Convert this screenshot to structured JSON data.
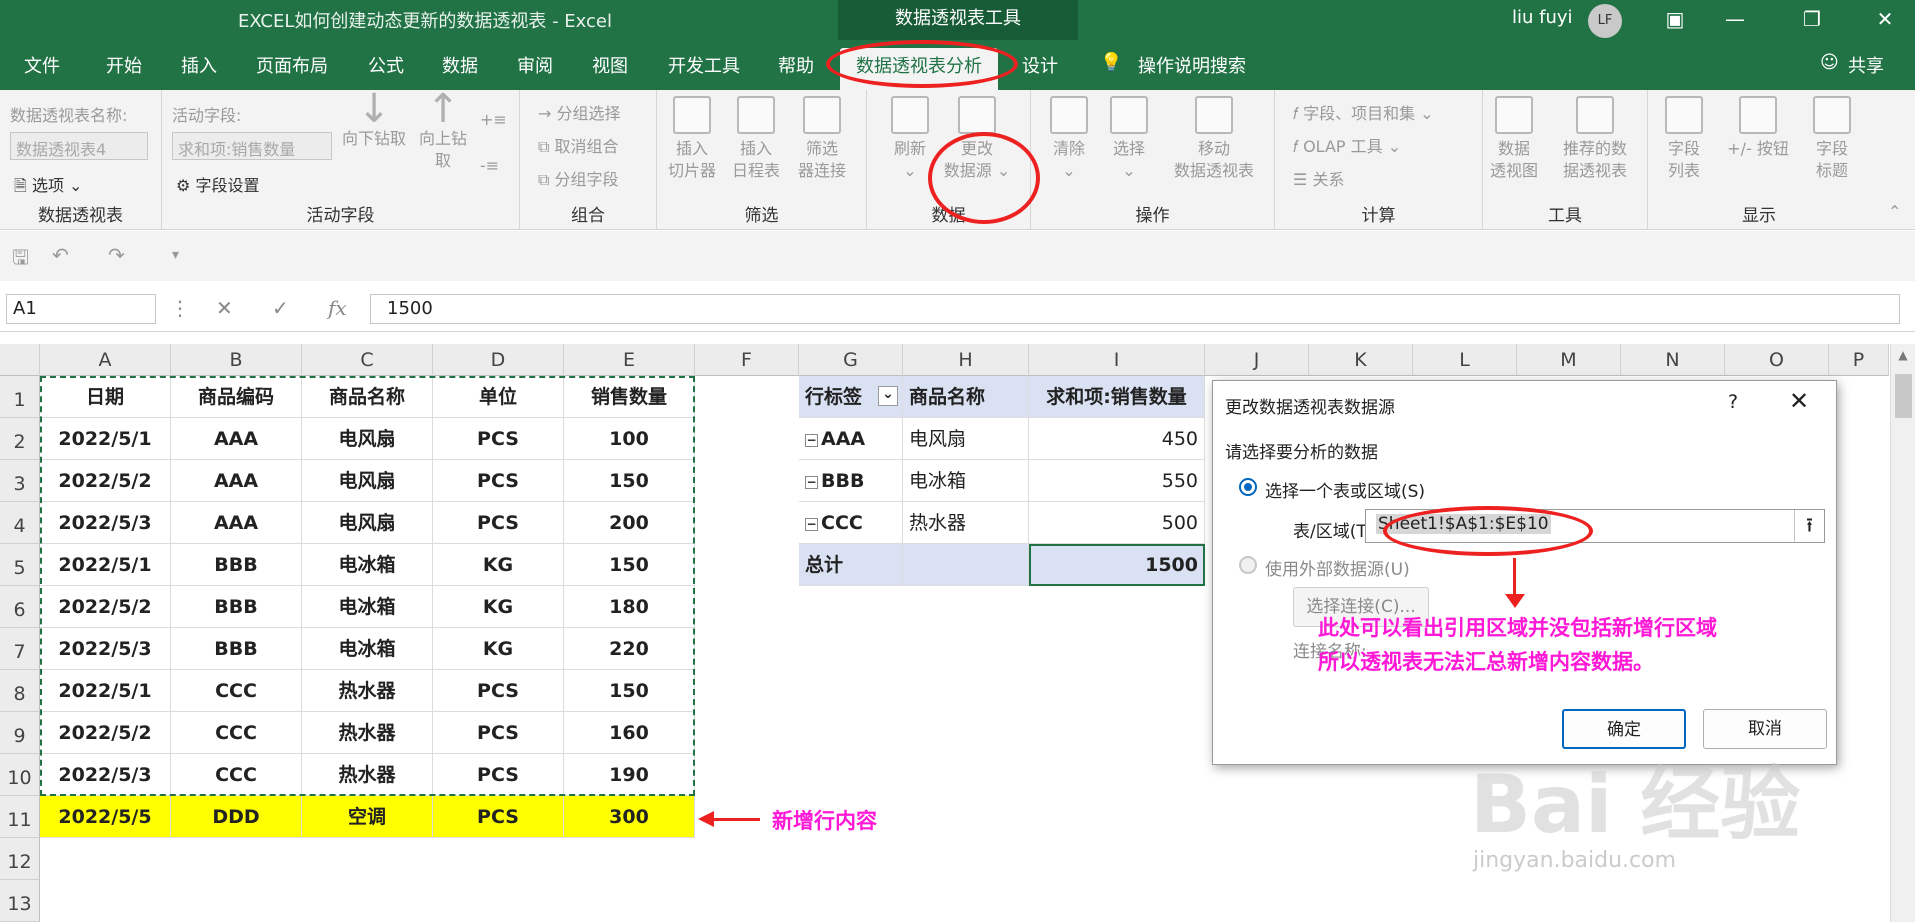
{
  "window": {
    "title": "EXCEL如何创建动态更新的数据透视表  -  Excel",
    "contextual_tools": "数据透视表工具",
    "user": "liu fuyi",
    "avatar": "LF"
  },
  "tabs": [
    "文件",
    "开始",
    "插入",
    "页面布局",
    "公式",
    "数据",
    "审阅",
    "视图",
    "开发工具",
    "帮助",
    "数据透视表分析",
    "设计"
  ],
  "tell_me": "操作说明搜索",
  "share": "共享",
  "ribbon": {
    "pivot_name_label": "数据透视表名称:",
    "pivot_name_value": "数据透视表4",
    "options": "选项",
    "group_pivot": "数据透视表",
    "active_field_label": "活动字段:",
    "active_field_value": "求和项:销售数量",
    "field_settings": "字段设置",
    "drill_down": "向下钻取",
    "drill_up": "向上钻",
    "drill_up2": "取",
    "group_active": "活动字段",
    "group_selection": "分组选择",
    "ungroup": "取消组合",
    "group_field": "分组字段",
    "group_group": "组合",
    "insert_slicer_1": "插入",
    "insert_slicer_2": "切片器",
    "insert_timeline_1": "插入",
    "insert_timeline_2": "日程表",
    "filter_conn_1": "筛选",
    "filter_conn_2": "器连接",
    "group_filter": "筛选",
    "refresh": "刷新",
    "change_source_1": "更改",
    "change_source_2": "数据源",
    "group_data": "数据",
    "clear": "清除",
    "select": "选择",
    "move_1": "移动",
    "move_2": "数据透视表",
    "group_actions": "操作",
    "fields_items": "字段、项目和集",
    "olap": "OLAP 工具",
    "relations": "关系",
    "group_calc": "计算",
    "pivot_chart_1": "数据",
    "pivot_chart_2": "透视图",
    "recommended_1": "推荐的数",
    "recommended_2": "据透视表",
    "group_tools": "工具",
    "field_list_1": "字段",
    "field_list_2": "列表",
    "plus_minus": "+/- 按钮",
    "field_headers_1": "字段",
    "field_headers_2": "标题",
    "group_show": "显示"
  },
  "namebox": "A1",
  "formula": "1500",
  "columns": [
    "A",
    "B",
    "C",
    "D",
    "E",
    "F",
    "G",
    "H",
    "I",
    "J",
    "K",
    "L",
    "M",
    "N",
    "O",
    "P"
  ],
  "rows": [
    "1",
    "2",
    "3",
    "4",
    "5",
    "6",
    "7",
    "8",
    "9",
    "10",
    "11",
    "12",
    "13"
  ],
  "source_headers": [
    "日期",
    "商品编码",
    "商品名称",
    "单位",
    "销售数量"
  ],
  "source_rows": [
    [
      "2022/5/1",
      "AAA",
      "电风扇",
      "PCS",
      "100"
    ],
    [
      "2022/5/2",
      "AAA",
      "电风扇",
      "PCS",
      "150"
    ],
    [
      "2022/5/3",
      "AAA",
      "电风扇",
      "PCS",
      "200"
    ],
    [
      "2022/5/1",
      "BBB",
      "电冰箱",
      "KG",
      "150"
    ],
    [
      "2022/5/2",
      "BBB",
      "电冰箱",
      "KG",
      "180"
    ],
    [
      "2022/5/3",
      "BBB",
      "电冰箱",
      "KG",
      "220"
    ],
    [
      "2022/5/1",
      "CCC",
      "热水器",
      "PCS",
      "150"
    ],
    [
      "2022/5/2",
      "CCC",
      "热水器",
      "PCS",
      "160"
    ],
    [
      "2022/5/3",
      "CCC",
      "热水器",
      "PCS",
      "190"
    ],
    [
      "2022/5/5",
      "DDD",
      "空调",
      "PCS",
      "300"
    ]
  ],
  "pivot": {
    "headers": [
      "行标签",
      "商品名称",
      "求和项:销售数量"
    ],
    "rows": [
      [
        "AAA",
        "电风扇",
        "450"
      ],
      [
        "BBB",
        "电冰箱",
        "550"
      ],
      [
        "CCC",
        "热水器",
        "500"
      ]
    ],
    "total_label": "总计",
    "total_value": "1500"
  },
  "dialog": {
    "title": "更改数据透视表数据源",
    "help": "?",
    "close": "✕",
    "subtitle": "请选择要分析的数据",
    "option_table": "选择一个表或区域(S)",
    "range_label": "表/区域(T):",
    "range_value": "Sheet1!$A$1:$E$10",
    "option_external": "使用外部数据源(U)",
    "choose_conn": "选择连接(C)...",
    "conn_name": "连接名称:",
    "ok": "确定",
    "cancel": "取消"
  },
  "annotations": {
    "new_row": "新增行内容",
    "note_line1": "此处可以看出引用区域并没包括新增行区域",
    "note_line2": "所以透视表无法汇总新增内容数据。"
  },
  "watermark": {
    "brand": "Bai 经验",
    "url": "jingyan.baidu.com"
  },
  "colors": {
    "excel_green": "#217346",
    "highlight_yellow": "#ffff00",
    "pivot_header": "#d9e1f2",
    "annotation_pink": "#ff19d6",
    "annotation_red": "#ee2121"
  }
}
